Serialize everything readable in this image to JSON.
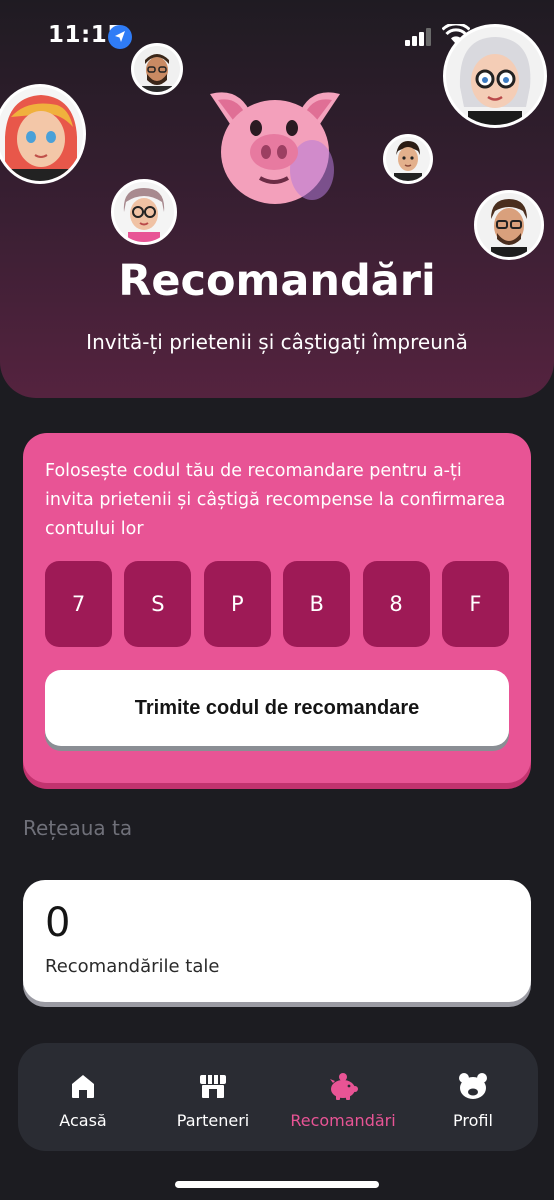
{
  "status_bar": {
    "time": "11:15"
  },
  "hero": {
    "title": "Recomandări",
    "subtitle": "Invită-ți prietenii și câștigați împreună"
  },
  "referral": {
    "description": "Folosește codul tău de recomandare pentru a-ți invita prietenii și câștigă recompense la confirmarea contului lor",
    "code": [
      "7",
      "S",
      "P",
      "B",
      "8",
      "F"
    ],
    "send_label": "Trimite codul de recomandare"
  },
  "network": {
    "section_label": "Rețeaua ta",
    "count": "0",
    "count_label": "Recomandările tale"
  },
  "nav": {
    "items": [
      {
        "label": "Acasă",
        "icon": "home-icon"
      },
      {
        "label": "Parteneri",
        "icon": "store-icon"
      },
      {
        "label": "Recomandări",
        "icon": "piggy-bank-icon"
      },
      {
        "label": "Profil",
        "icon": "bear-face-icon"
      }
    ],
    "active_index": 2
  },
  "colors": {
    "accent": "#e85495",
    "code_box": "#9e1a56",
    "background": "#1c1c21"
  }
}
